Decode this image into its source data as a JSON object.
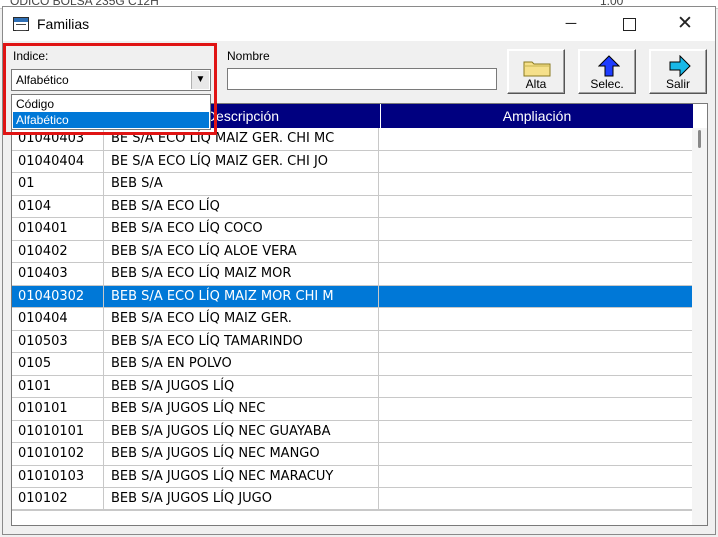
{
  "background_window": {
    "left_text": "ODICO BOLSA 235G C12H",
    "right_text": "1.00"
  },
  "window": {
    "title": "Familias",
    "minimize": "─",
    "maximize": "",
    "close": "✕"
  },
  "indice": {
    "label": "Indice:",
    "selected": "Alfabético",
    "arrow": "▼",
    "options": [
      "Código",
      "Alfabético"
    ]
  },
  "nombre": {
    "label": "Nombre",
    "value": ""
  },
  "toolbar": {
    "alta": "Alta",
    "selec": "Selec.",
    "salir": "Salir"
  },
  "table": {
    "headers": {
      "code": "",
      "description": "Descripción",
      "ampliacion": "Ampliación"
    },
    "selected_index": 7,
    "rows": [
      {
        "code": "01040403",
        "description": "BE  S/A  ECO LÍQ MAIZ GER. CHI MC",
        "ampliacion": ""
      },
      {
        "code": "01040404",
        "description": "BE  S/A  ECO LÍQ MAIZ GER. CHI JO",
        "ampliacion": ""
      },
      {
        "code": "01",
        "description": "BEB  S/A",
        "ampliacion": ""
      },
      {
        "code": "0104",
        "description": "BEB  S/A  ECO LÍQ",
        "ampliacion": ""
      },
      {
        "code": "010401",
        "description": "BEB  S/A  ECO LÍQ COCO",
        "ampliacion": ""
      },
      {
        "code": "010402",
        "description": "BEB  S/A  ECO LÍQ ALOE VERA",
        "ampliacion": ""
      },
      {
        "code": "010403",
        "description": "BEB  S/A  ECO LÍQ MAIZ MOR",
        "ampliacion": ""
      },
      {
        "code": "01040302",
        "description": "BEB  S/A  ECO LÍQ MAIZ MOR CHI M",
        "ampliacion": ""
      },
      {
        "code": "010404",
        "description": "BEB  S/A  ECO LÍQ MAIZ GER.",
        "ampliacion": ""
      },
      {
        "code": "010503",
        "description": "BEB  S/A  ECO LÍQ TAMARINDO",
        "ampliacion": ""
      },
      {
        "code": "0105",
        "description": "BEB  S/A  EN POLVO",
        "ampliacion": ""
      },
      {
        "code": "0101",
        "description": "BEB  S/A  JUGOS LÍQ",
        "ampliacion": ""
      },
      {
        "code": "010101",
        "description": "BEB  S/A  JUGOS LÍQ NEC",
        "ampliacion": ""
      },
      {
        "code": "01010101",
        "description": "BEB  S/A  JUGOS LÍQ NEC GUAYABA",
        "ampliacion": ""
      },
      {
        "code": "01010102",
        "description": "BEB  S/A  JUGOS LÍQ NEC MANGO",
        "ampliacion": ""
      },
      {
        "code": "01010103",
        "description": "BEB  S/A  JUGOS LÍQ NEC MARACUY",
        "ampliacion": ""
      },
      {
        "code": "010102",
        "description": "BEB  S/A  JUGOS LÍQ JUGO",
        "ampliacion": ""
      }
    ]
  },
  "colors": {
    "header_bg": "#000080",
    "selection": "#0078d7",
    "annotation_border": "#e01414"
  }
}
